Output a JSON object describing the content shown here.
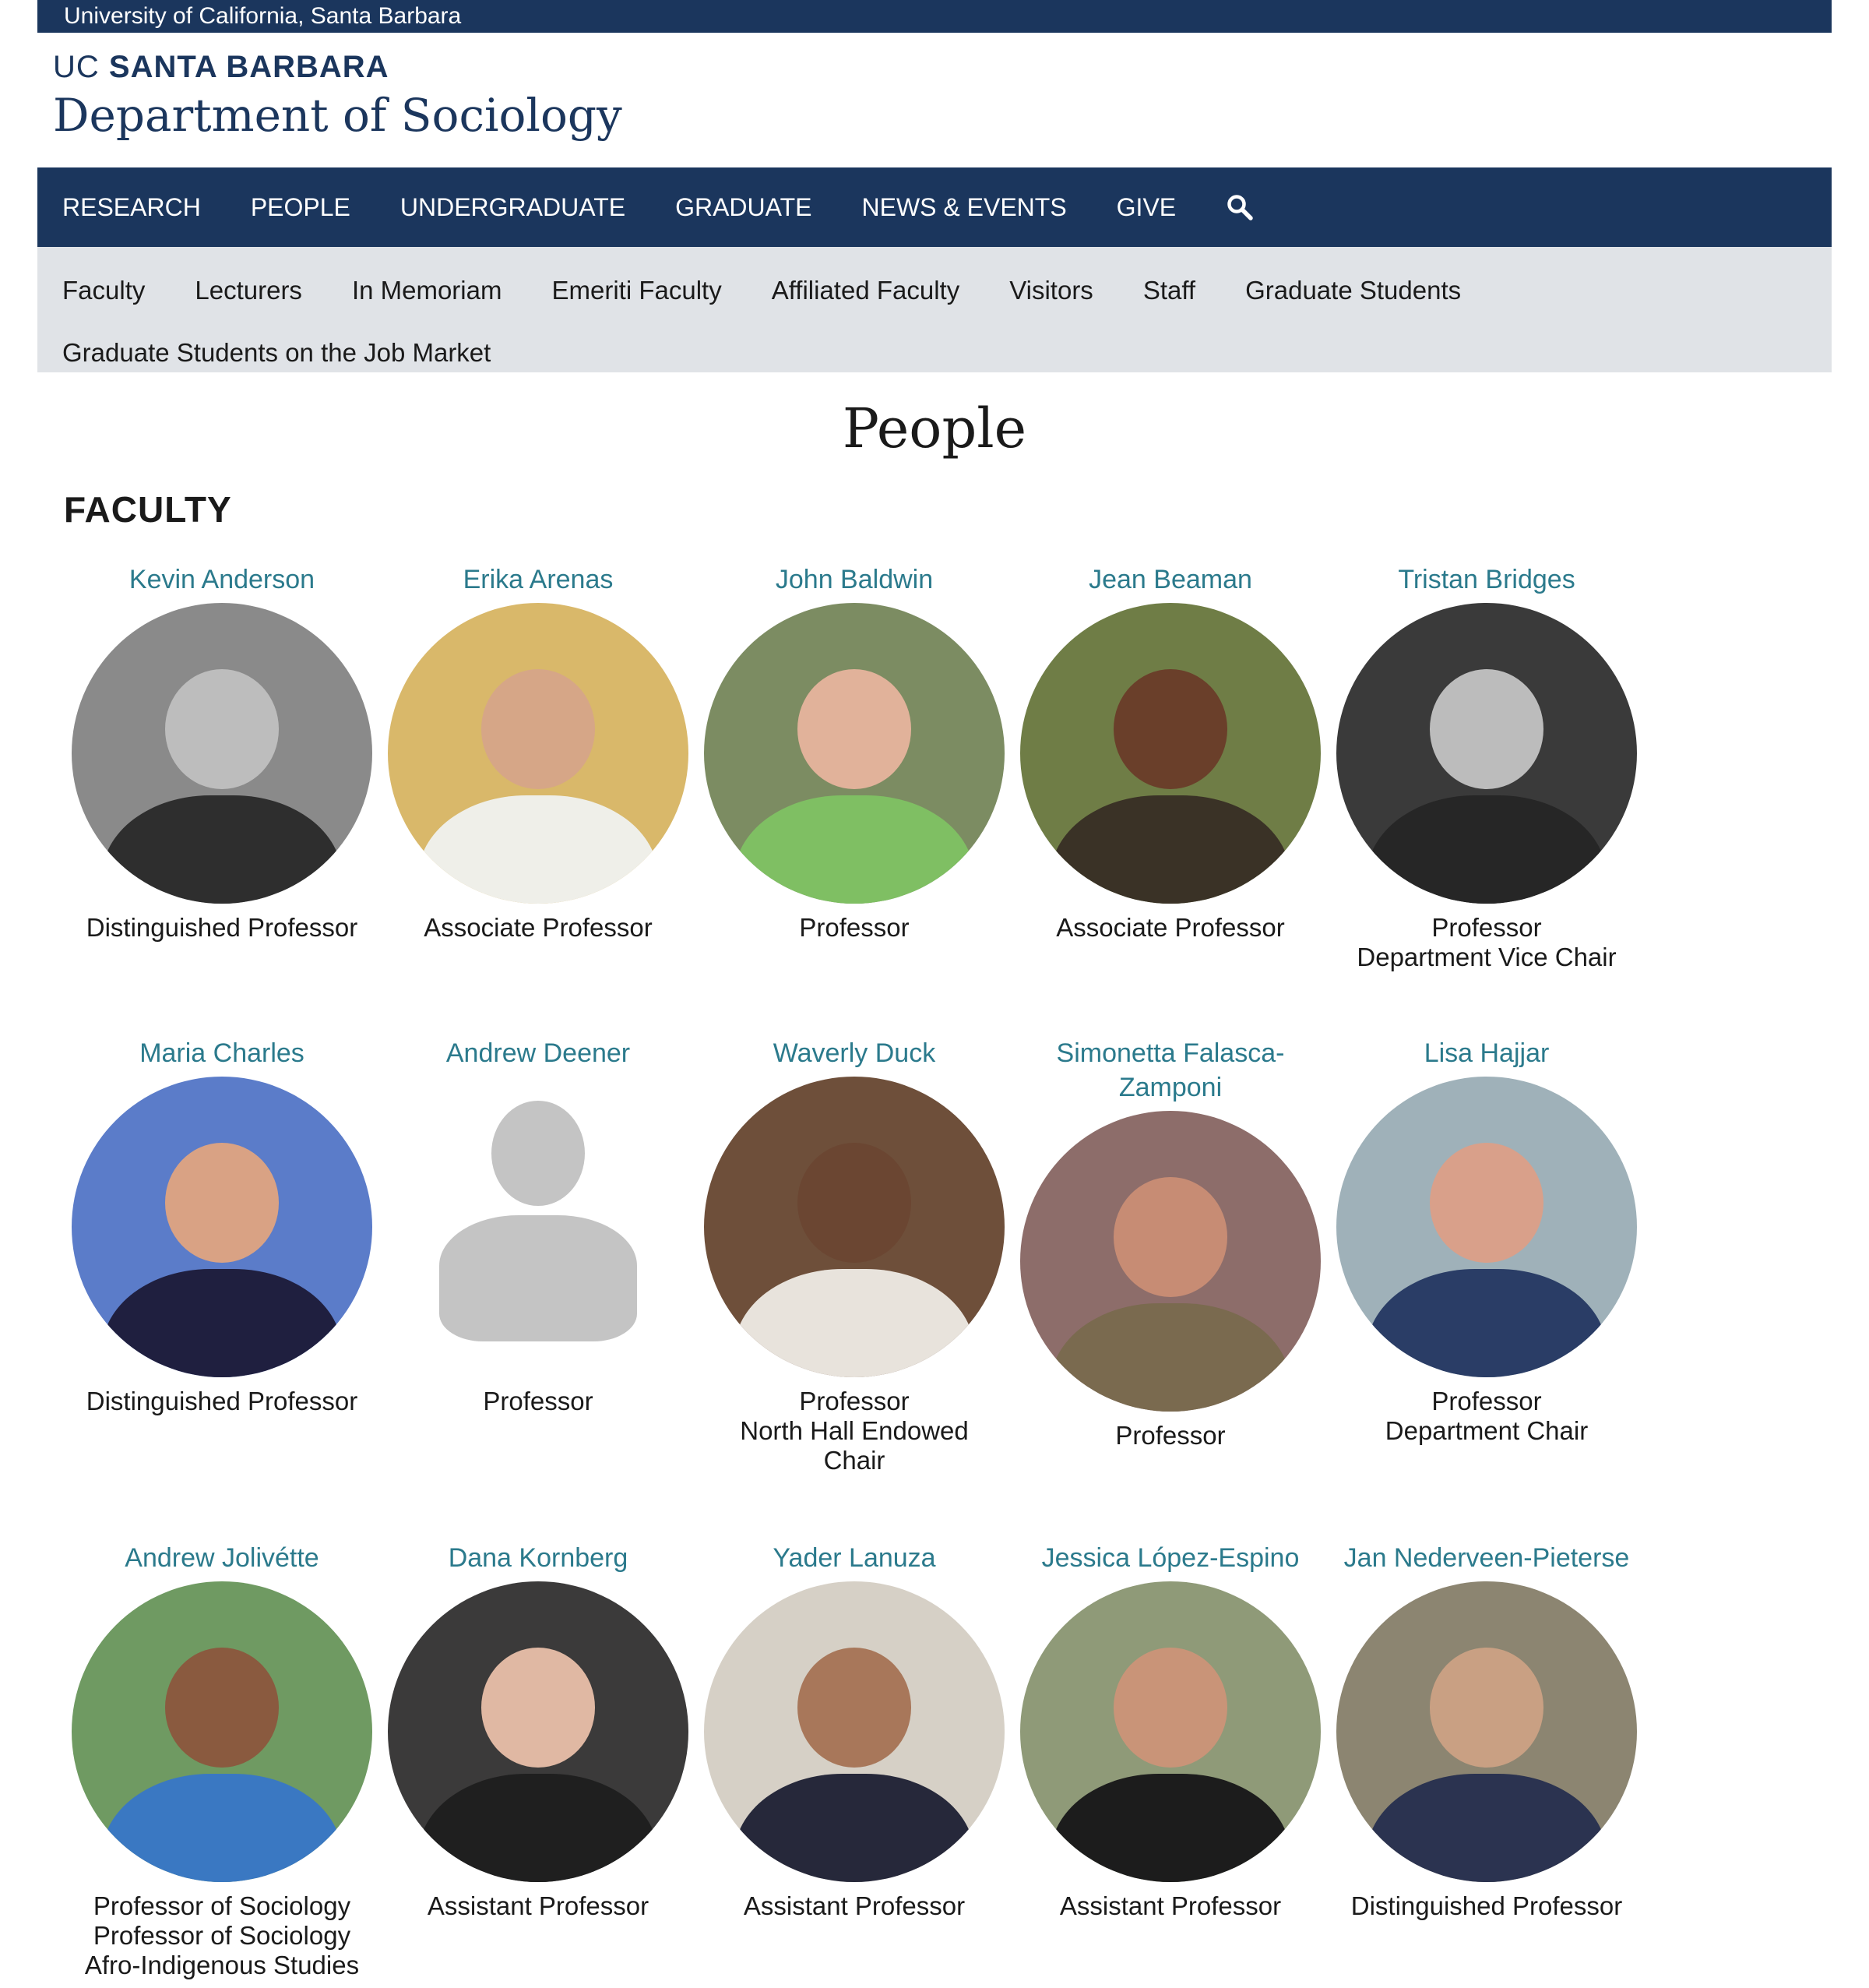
{
  "topbar": {
    "text": "University of California, Santa Barbara"
  },
  "brand": {
    "uc": "UC",
    "sb": "SANTA BARBARA",
    "department": "Department of Sociology"
  },
  "mainnav": {
    "items": [
      "RESEARCH",
      "PEOPLE",
      "UNDERGRADUATE",
      "GRADUATE",
      "NEWS & EVENTS",
      "GIVE"
    ],
    "search_icon": "search-icon"
  },
  "subnav": {
    "row1": [
      "Faculty",
      "Lecturers",
      "In Memoriam",
      "Emeriti Faculty",
      "Affiliated Faculty",
      "Visitors",
      "Staff",
      "Graduate Students"
    ],
    "row2": [
      "Graduate Students on the Job Market"
    ]
  },
  "page": {
    "title": "People",
    "section": "FACULTY"
  },
  "colors": {
    "navy": "#1b365d",
    "link": "#2b7a8c",
    "subnav_bg": "#e0e3e7"
  },
  "faculty": [
    {
      "name": "Kevin Anderson",
      "titles": [
        "Distinguished Professor"
      ],
      "bg": "#8a8a8a",
      "skin": "#bdbdbd",
      "cloth": "#2e2e2e"
    },
    {
      "name": "Erika Arenas",
      "titles": [
        "Associate Professor"
      ],
      "bg": "#d9b86a",
      "skin": "#d6a687",
      "cloth": "#efefe9"
    },
    {
      "name": "John Baldwin",
      "titles": [
        "Professor"
      ],
      "bg": "#7c8c62",
      "skin": "#e1b29a",
      "cloth": "#7fbf63"
    },
    {
      "name": "Jean Beaman",
      "titles": [
        "Associate Professor"
      ],
      "bg": "#6f7d46",
      "skin": "#6a3f2a",
      "cloth": "#3a3226"
    },
    {
      "name": "Tristan Bridges",
      "titles": [
        "Professor",
        "Department Vice Chair"
      ],
      "bg": "#3a3a3a",
      "skin": "#bcbcbc",
      "cloth": "#262626"
    },
    {
      "name": "Maria Charles",
      "titles": [
        "Distinguished Professor"
      ],
      "bg": "#5b7cc9",
      "skin": "#d9a284",
      "cloth": "#1f1f3f"
    },
    {
      "name": "Andrew Deener",
      "titles": [
        "Professor"
      ],
      "bg": "#ffffff",
      "skin": "#c4c4c4",
      "cloth": "#c4c4c4",
      "placeholder": true
    },
    {
      "name": "Waverly Duck",
      "titles": [
        "Professor",
        "North Hall Endowed",
        "Chair"
      ],
      "bg": "#6e4f3a",
      "skin": "#6b4632",
      "cloth": "#e8e3dc"
    },
    {
      "name": "Simonetta Falasca-Zamponi",
      "titles": [
        "Professor"
      ],
      "bg": "#8d6d6a",
      "skin": "#c78c74",
      "cloth": "#7a6a4f"
    },
    {
      "name": "Lisa Hajjar",
      "titles": [
        "Professor",
        "Department Chair"
      ],
      "bg": "#9fb1b9",
      "skin": "#d9a08a",
      "cloth": "#2a3d66"
    },
    {
      "name": "Andrew Jolivétte",
      "titles": [
        "Professor of Sociology",
        "Professor of Sociology",
        "Afro-Indigenous Studies"
      ],
      "bg": "#6f9a62",
      "skin": "#8a5a3f",
      "cloth": "#3a78c2"
    },
    {
      "name": "Dana Kornberg",
      "titles": [
        "Assistant Professor"
      ],
      "bg": "#3b3a3a",
      "skin": "#e0b8a3",
      "cloth": "#1f1f1f"
    },
    {
      "name": "Yader Lanuza",
      "titles": [
        "Assistant Professor"
      ],
      "bg": "#d6d0c6",
      "skin": "#a8775a",
      "cloth": "#26283a"
    },
    {
      "name": "Jessica López-Espino",
      "titles": [
        "Assistant Professor"
      ],
      "bg": "#8f9a78",
      "skin": "#c99478",
      "cloth": "#1c1c1c"
    },
    {
      "name": "Jan Nederveen-Pieterse",
      "titles": [
        "Distinguished Professor"
      ],
      "bg": "#8c8571",
      "skin": "#c9a083",
      "cloth": "#2b3350"
    }
  ]
}
